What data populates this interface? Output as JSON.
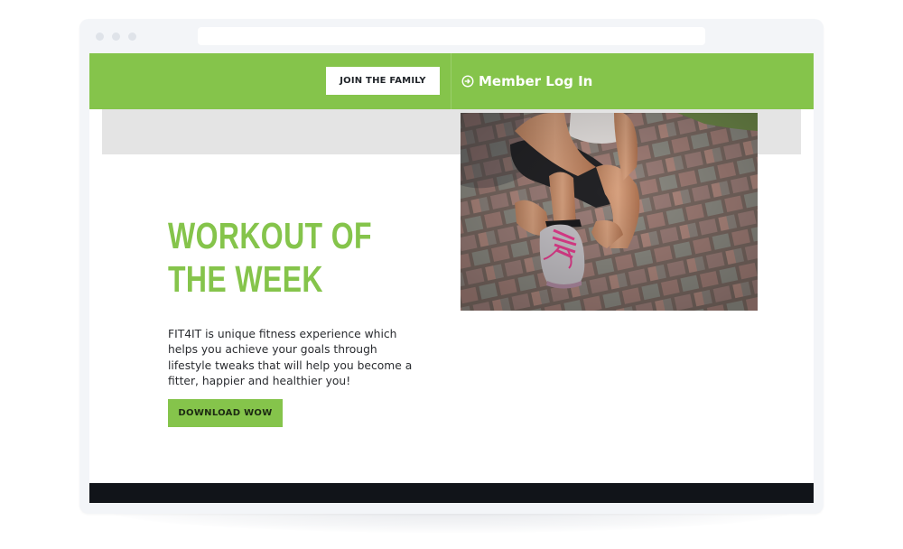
{
  "colors": {
    "brand_green": "#85c44b",
    "footer_dark": "#111419",
    "gray_band": "#e4e4e4",
    "text_dark": "#2a2c30"
  },
  "header": {
    "join_label": "JOIN THE FAMILY",
    "login_label": "Member Log In",
    "login_icon": "login-arrow-icon"
  },
  "hero": {
    "title": "WORKOUT OF THE WEEK",
    "description": "FIT4IT is unique fitness experience which helps you achieve your goals through lifestyle tweaks that will help you become a fitter, happier and healthier you!",
    "download_label": "DOWNLOAD WOW",
    "photo_subject": "tying-running-shoe-photo"
  }
}
